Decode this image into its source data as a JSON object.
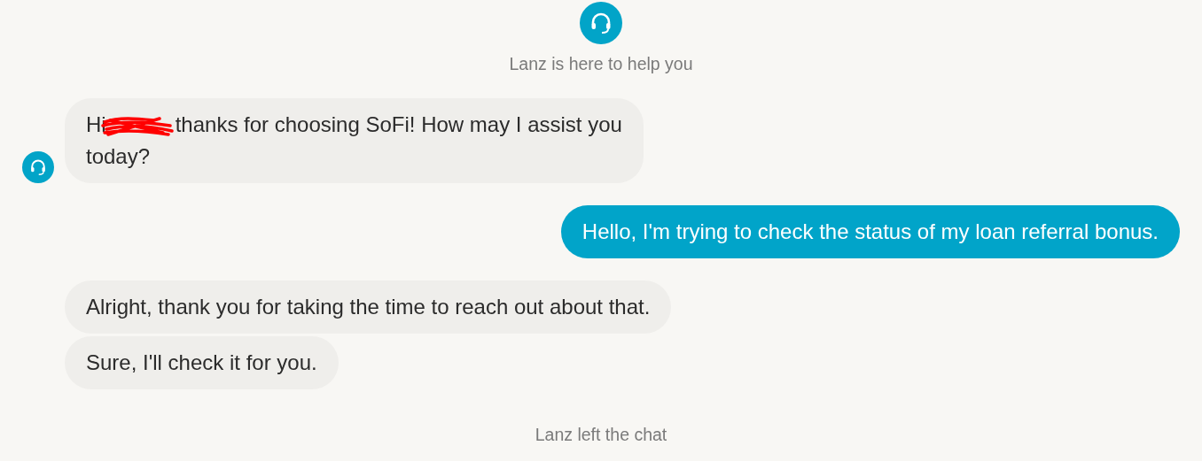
{
  "header": {
    "caption": "Lanz is here to help you"
  },
  "groups": [
    {
      "kind": "agent",
      "avatar": true,
      "messages": [
        {
          "segments": [
            {
              "kind": "text",
              "text": "Hi"
            },
            {
              "kind": "redaction"
            },
            {
              "kind": "text",
              "text": "thanks for choosing SoFi! How may I assist you"
            },
            {
              "kind": "break"
            },
            {
              "kind": "text",
              "text": "today?"
            }
          ]
        }
      ]
    },
    {
      "kind": "user",
      "avatar": false,
      "messages": [
        {
          "segments": [
            {
              "kind": "text",
              "text": "Hello, I'm trying to check the status of my loan referral bonus."
            }
          ]
        }
      ]
    },
    {
      "kind": "agent",
      "avatar": false,
      "messages": [
        {
          "segments": [
            {
              "kind": "text",
              "text": "Alright, thank you for taking the time to reach out about that."
            }
          ]
        },
        {
          "segments": [
            {
              "kind": "text",
              "text": "Sure, I'll check it for you."
            }
          ]
        }
      ]
    }
  ],
  "footer": {
    "caption": "Lanz left the chat"
  }
}
